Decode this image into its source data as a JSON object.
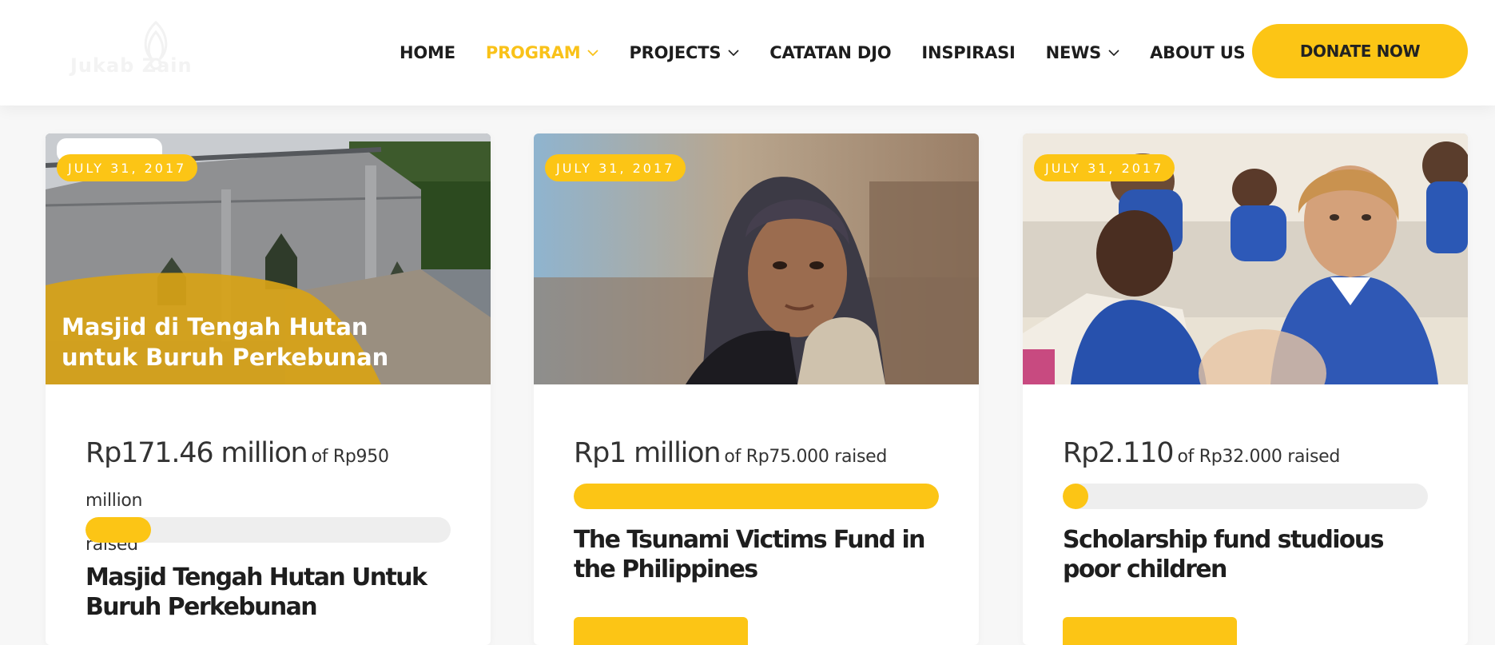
{
  "brand": {
    "logo_text": "Jukab Zain"
  },
  "nav": {
    "items": [
      {
        "label": "HOME",
        "has_dropdown": false,
        "active": false
      },
      {
        "label": "PROGRAM",
        "has_dropdown": true,
        "active": true
      },
      {
        "label": "PROJECTS",
        "has_dropdown": true,
        "active": false
      },
      {
        "label": "CATATAN DJO",
        "has_dropdown": false,
        "active": false
      },
      {
        "label": "INSPIRASI",
        "has_dropdown": false,
        "active": false
      },
      {
        "label": "NEWS",
        "has_dropdown": true,
        "active": false
      },
      {
        "label": "ABOUT US",
        "has_dropdown": true,
        "active": false
      }
    ],
    "donate_label": "DONATE NOW"
  },
  "colors": {
    "accent": "#fcc515",
    "text_dark": "#1e1e1e",
    "track": "#eeeeee"
  },
  "cards": [
    {
      "date": "JULY 31, 2017",
      "image_caption_line1": "Masjid di Tengah Hutan",
      "image_caption_line2": "untuk Buruh Perkebunan",
      "raised": "Rp171.46 million",
      "goal_text": "of Rp950 million",
      "raised_word": "raised",
      "progress_percent": 18,
      "title": "Masjid Tengah Hutan Untuk Buruh Perkebunan"
    },
    {
      "date": "JULY 31, 2017",
      "raised": "Rp1 million",
      "goal_text": "of Rp75.000 raised",
      "progress_percent": 100,
      "title": "The Tsunami Victims Fund in the Philippines"
    },
    {
      "date": "JULY 31, 2017",
      "raised": "Rp2.110",
      "goal_text": "of Rp32.000 raised",
      "progress_percent": 7,
      "title": "Scholarship fund studious poor children"
    }
  ]
}
